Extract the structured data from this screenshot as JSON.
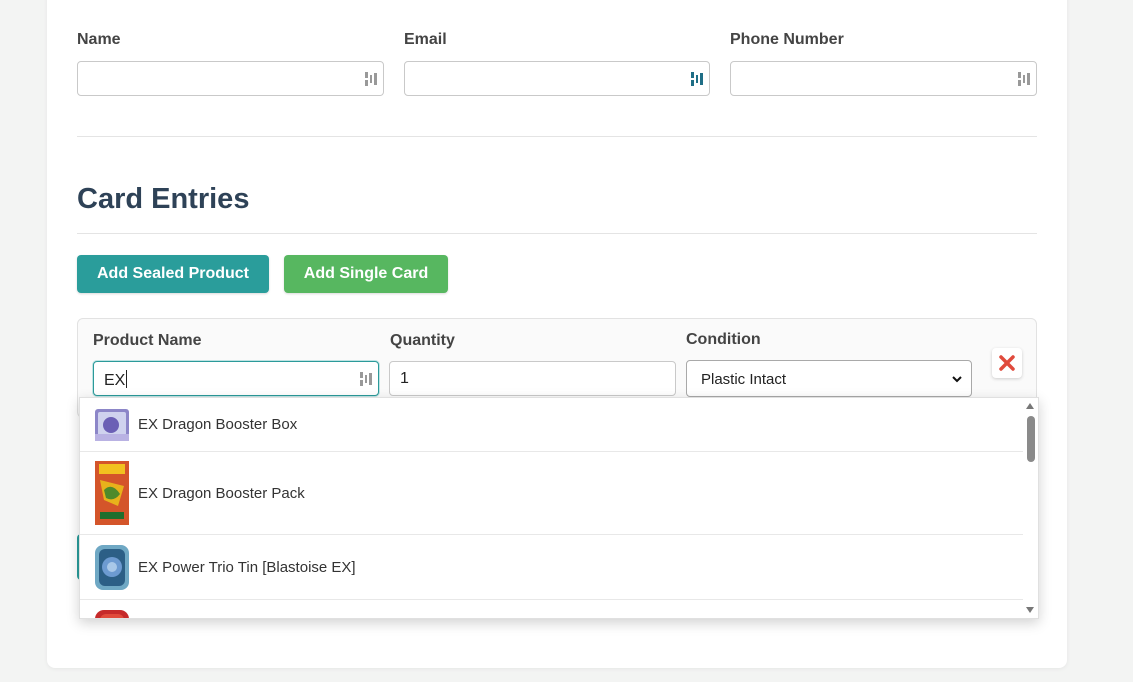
{
  "customer": {
    "name_label": "Name",
    "email_label": "Email",
    "phone_label": "Phone Number",
    "name_value": "",
    "email_value": "",
    "phone_value": ""
  },
  "section": {
    "title": "Card Entries",
    "add_sealed_label": "Add Sealed Product",
    "add_single_label": "Add Single Card"
  },
  "entry": {
    "product_label": "Product Name",
    "quantity_label": "Quantity",
    "condition_label": "Condition",
    "product_value": "EX",
    "quantity_value": "1",
    "condition_value": "Plastic Intact"
  },
  "suggestions": [
    {
      "label": "EX Dragon Booster Box",
      "icon": "booster-box-icon"
    },
    {
      "label": "EX Dragon Booster Pack",
      "icon": "booster-pack-icon"
    },
    {
      "label": "EX Power Trio Tin [Blastoise EX]",
      "icon": "tin-icon"
    }
  ],
  "colors": {
    "accent_teal": "#2a9d9b",
    "accent_green": "#57b760",
    "title": "#2e4257",
    "danger": "#e04a3c"
  }
}
